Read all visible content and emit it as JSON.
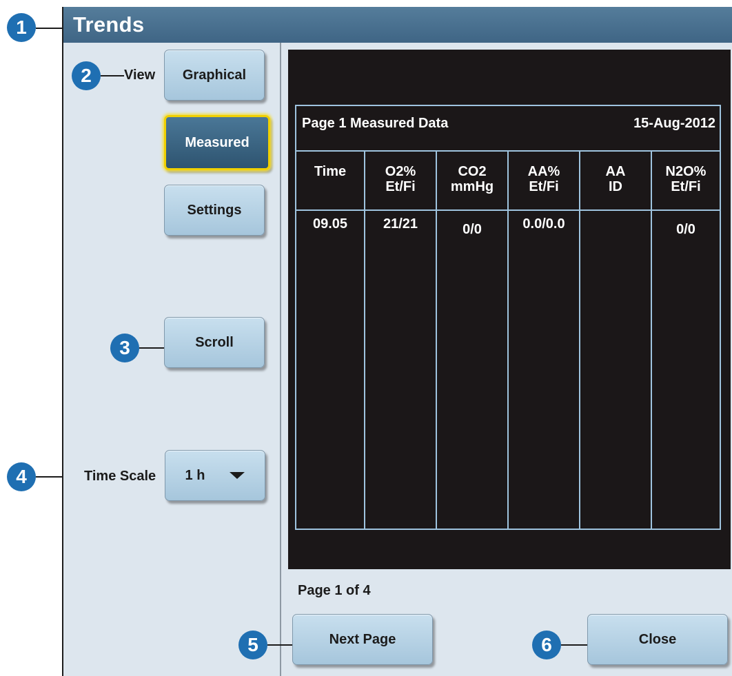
{
  "window": {
    "title": "Trends"
  },
  "view": {
    "label": "View",
    "buttons": [
      "Graphical",
      "Measured",
      "Settings"
    ],
    "selected": "Measured"
  },
  "scroll": {
    "label": "Scroll"
  },
  "time_scale": {
    "label": "Time Scale",
    "value": "1 h"
  },
  "table": {
    "title": "Page 1 Measured Data",
    "date": "15-Aug-2012",
    "columns": [
      {
        "line1": "Time",
        "line2": "",
        "value": "09.05"
      },
      {
        "line1": "O2%",
        "line2": "Et/Fi",
        "value": "21/21"
      },
      {
        "line1": "CO2",
        "line2": "mmHg",
        "value": "0/0"
      },
      {
        "line1": "AA%",
        "line2": "Et/Fi",
        "value": "0.0/0.0"
      },
      {
        "line1": "AA",
        "line2": "ID",
        "value": ""
      },
      {
        "line1": "N2O%",
        "line2": "Et/Fi",
        "value": "0/0"
      }
    ]
  },
  "footer": {
    "page_info": "Page 1 of 4",
    "next_label": "Next Page",
    "close_label": "Close"
  },
  "callouts": [
    "1",
    "2",
    "3",
    "4",
    "5",
    "6"
  ],
  "colors": {
    "accent": "#1f6fb2",
    "titlebar": "#4a7191",
    "selected_border": "#f0d000"
  }
}
